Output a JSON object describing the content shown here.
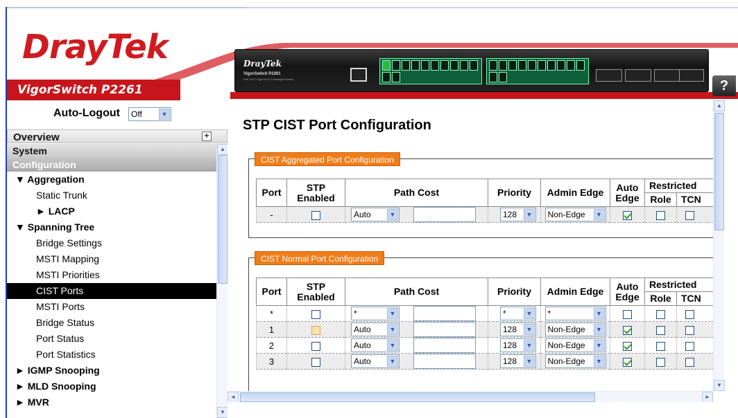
{
  "header": {
    "brand": "DrayTek",
    "model": "VigorSwitch P2261",
    "device_brand": "DrayTek",
    "device_model": "VigorSwitch P2261",
    "device_subtitle": "PoE 24+2 Giga Port L2 Managed Switch",
    "help_label": "?"
  },
  "sidebar": {
    "autologout_label": "Auto-Logout",
    "autologout_value": "Off",
    "overview": "Overview",
    "system": "System",
    "configuration": "Configuration",
    "items": [
      {
        "label": "▼ Aggregation",
        "type": "group"
      },
      {
        "label": "Static Trunk",
        "type": "sub"
      },
      {
        "label": "► LACP",
        "type": "subsub"
      },
      {
        "label": "▼ Spanning Tree",
        "type": "group"
      },
      {
        "label": "Bridge Settings",
        "type": "sub"
      },
      {
        "label": "MSTI Mapping",
        "type": "sub"
      },
      {
        "label": "MSTI Priorities",
        "type": "sub"
      },
      {
        "label": "CIST Ports",
        "type": "sub",
        "active": true
      },
      {
        "label": "MSTI Ports",
        "type": "sub"
      },
      {
        "label": "Bridge Status",
        "type": "sub"
      },
      {
        "label": "Port Status",
        "type": "sub"
      },
      {
        "label": "Port Statistics",
        "type": "sub"
      },
      {
        "label": "► IGMP Snooping",
        "type": "group"
      },
      {
        "label": "► MLD Snooping",
        "type": "group"
      },
      {
        "label": "► MVR",
        "type": "group"
      }
    ]
  },
  "main": {
    "title": "STP CIST Port Configuration",
    "aggregated": {
      "legend": "CIST Aggregated Port Configuration",
      "row": {
        "port": "-",
        "stp": false,
        "path_cost": "Auto",
        "priority": "128",
        "admin_edge": "Non-Edge",
        "auto_edge": true,
        "role": false,
        "tcn": false
      }
    },
    "normal": {
      "legend": "CIST Normal Port Configuration",
      "rows": [
        {
          "port": "*",
          "stp": false,
          "path_cost": "*",
          "priority": "*",
          "admin_edge": "*",
          "auto_edge": false,
          "role": false,
          "tcn": false
        },
        {
          "port": "1",
          "stp": false,
          "stp_hover": true,
          "path_cost": "Auto",
          "priority": "128",
          "admin_edge": "Non-Edge",
          "auto_edge": true,
          "role": false,
          "tcn": false
        },
        {
          "port": "2",
          "stp": false,
          "path_cost": "Auto",
          "priority": "128",
          "admin_edge": "Non-Edge",
          "auto_edge": true,
          "role": false,
          "tcn": false
        },
        {
          "port": "3",
          "stp": false,
          "path_cost": "Auto",
          "priority": "128",
          "admin_edge": "Non-Edge",
          "auto_edge": true,
          "role": false,
          "tcn": false
        }
      ]
    },
    "columns": {
      "port": "Port",
      "stp_enabled": "STP Enabled",
      "path_cost": "Path Cost",
      "priority": "Priority",
      "admin_edge": "Admin Edge",
      "auto_edge": "Auto Edge",
      "restricted": "Restricted",
      "role": "Role",
      "tcn": "TCN"
    }
  },
  "colors": {
    "brand_red": "#c8151b",
    "legend_orange": "#f07d1a",
    "active_nav": "#000000"
  }
}
